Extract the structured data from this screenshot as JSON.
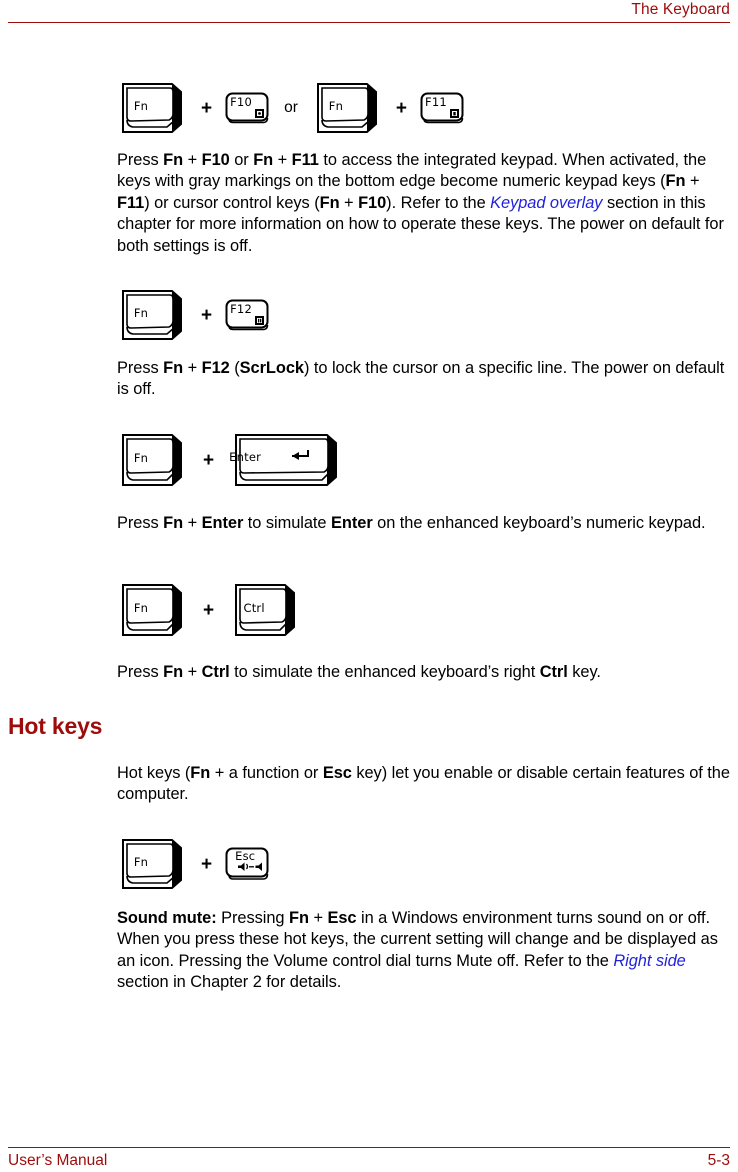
{
  "header": {
    "title": "The Keyboard"
  },
  "footer": {
    "left": "User’s Manual",
    "right": "5-3"
  },
  "keys": {
    "fn": "Fn",
    "f10": "F10",
    "f11": "F11",
    "f12": "F12",
    "enter": "Enter",
    "ctrl": "Ctrl",
    "esc": "Esc",
    "plus": "+",
    "or": "or"
  },
  "figures": {
    "fig1": {
      "name": "fn-f10-or-fn-f11",
      "icons": [
        "cursor-overlay-icon",
        "numeric-overlay-icon"
      ]
    },
    "fig2": {
      "name": "fn-f12",
      "icons": [
        "scroll-lock-icon"
      ]
    },
    "fig3": {
      "name": "fn-enter",
      "icons": [
        "enter-arrow-icon"
      ]
    },
    "fig4": {
      "name": "fn-ctrl",
      "icons": []
    },
    "fig5": {
      "name": "fn-esc",
      "icons": [
        "sound-mute-icon"
      ]
    }
  },
  "paragraphs": {
    "p_keypad": {
      "segments": [
        {
          "text": "Press ",
          "style": "normal"
        },
        {
          "text": "Fn",
          "style": "bold"
        },
        {
          "text": " + ",
          "style": "normal"
        },
        {
          "text": "F10",
          "style": "bold"
        },
        {
          "text": " or ",
          "style": "normal"
        },
        {
          "text": "Fn",
          "style": "bold"
        },
        {
          "text": " + ",
          "style": "normal"
        },
        {
          "text": "F11",
          "style": "bold"
        },
        {
          "text": " to access the integrated keypad. When activated, the keys with gray markings on the bottom edge become numeric keypad keys (",
          "style": "normal"
        },
        {
          "text": "Fn",
          "style": "bold"
        },
        {
          "text": " + ",
          "style": "normal"
        },
        {
          "text": "F11",
          "style": "bold"
        },
        {
          "text": ") or cursor control keys (",
          "style": "normal"
        },
        {
          "text": "Fn",
          "style": "bold"
        },
        {
          "text": " + ",
          "style": "normal"
        },
        {
          "text": "F10",
          "style": "bold"
        },
        {
          "text": "). Refer to the ",
          "style": "normal"
        },
        {
          "text": "Keypad overlay",
          "style": "xref"
        },
        {
          "text": " section in this chapter for more information on how to operate these keys. The power on default for both settings is off.",
          "style": "normal"
        }
      ]
    },
    "p_scrlock": {
      "segments": [
        {
          "text": "Press ",
          "style": "normal"
        },
        {
          "text": "Fn",
          "style": "bold"
        },
        {
          "text": " + ",
          "style": "normal"
        },
        {
          "text": "F12",
          "style": "bold"
        },
        {
          "text": " (",
          "style": "normal"
        },
        {
          "text": "ScrLock",
          "style": "bold"
        },
        {
          "text": ") to lock the cursor on a specific line. The power on default is off.",
          "style": "normal"
        }
      ]
    },
    "p_enter": {
      "segments": [
        {
          "text": "Press ",
          "style": "normal"
        },
        {
          "text": "Fn",
          "style": "bold"
        },
        {
          "text": " + ",
          "style": "normal"
        },
        {
          "text": "Enter",
          "style": "bold"
        },
        {
          "text": " to simulate ",
          "style": "normal"
        },
        {
          "text": "Enter",
          "style": "bold"
        },
        {
          "text": " on the enhanced keyboard’s numeric keypad.",
          "style": "normal"
        }
      ]
    },
    "p_ctrl": {
      "segments": [
        {
          "text": "Press ",
          "style": "normal"
        },
        {
          "text": "Fn",
          "style": "bold"
        },
        {
          "text": " + ",
          "style": "normal"
        },
        {
          "text": "Ctrl",
          "style": "bold"
        },
        {
          "text": " to simulate the enhanced keyboard’s right ",
          "style": "normal"
        },
        {
          "text": "Ctrl",
          "style": "bold"
        },
        {
          "text": " key.",
          "style": "normal"
        }
      ]
    },
    "p_hotkeys_intro": {
      "segments": [
        {
          "text": "Hot keys (",
          "style": "normal"
        },
        {
          "text": "Fn",
          "style": "bold"
        },
        {
          "text": " + a function or ",
          "style": "normal"
        },
        {
          "text": "Esc",
          "style": "bold"
        },
        {
          "text": " key) let you enable or disable certain features of the computer.",
          "style": "normal"
        }
      ]
    },
    "p_soundmute": {
      "segments": [
        {
          "text": "Sound mute:",
          "style": "bold"
        },
        {
          "text": " Pressing ",
          "style": "normal"
        },
        {
          "text": "Fn",
          "style": "bold"
        },
        {
          "text": " + ",
          "style": "normal"
        },
        {
          "text": "Esc",
          "style": "bold"
        },
        {
          "text": " in a Windows environment turns sound on or off. When you press these hot keys, the current setting will change and be displayed as an icon. Pressing the Volume control dial turns Mute off. Refer to the ",
          "style": "normal"
        },
        {
          "text": "Right side",
          "style": "xref"
        },
        {
          "text": " section in Chapter 2 for details.",
          "style": "normal"
        }
      ]
    }
  },
  "headings": {
    "hot_keys": "Hot keys"
  },
  "colors": {
    "accent": "#9e0b0b",
    "link": "#2222dd",
    "text": "#000000",
    "background": "#ffffff"
  }
}
